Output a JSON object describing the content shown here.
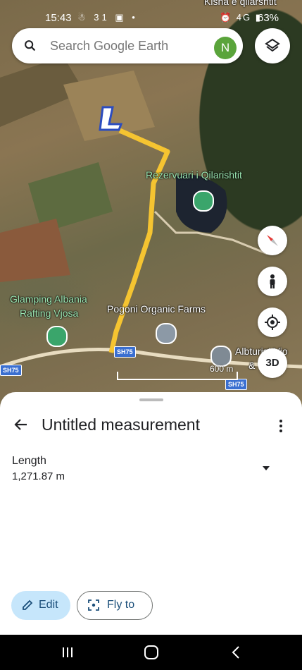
{
  "status_bar": {
    "time": "15:43",
    "left_icons": "☃ 31 ▣ •",
    "right_icons": "⏰ 4G ▮",
    "battery": "63%"
  },
  "top_bar": {
    "search_placeholder": "Search Google Earth",
    "avatar_initial": "N"
  },
  "map": {
    "labels": {
      "top_partial": "Kisha e qilarshtit",
      "reservoir": "Rezervuari i Qilarishtit",
      "glamping_line1": "Glamping Albania",
      "glamping_line2": "Rafting Vjosa",
      "farms": "Pogoni Organic Farms",
      "albturist_line1": "Albturist Vjo",
      "albturist_line2": "&"
    },
    "road_badges": [
      "SH75",
      "SH75",
      "SH75"
    ],
    "scale_label": "600 m",
    "btn_3d": "3D"
  },
  "sheet": {
    "title": "Untitled measurement",
    "length_label": "Length",
    "length_value": "1,271.87 m",
    "edit_label": "Edit",
    "fly_label": "Fly to"
  },
  "colors": {
    "measure_path": "#f5c431",
    "accent_blue": "#1b4f7a",
    "edit_bg": "#c6e6fb"
  }
}
